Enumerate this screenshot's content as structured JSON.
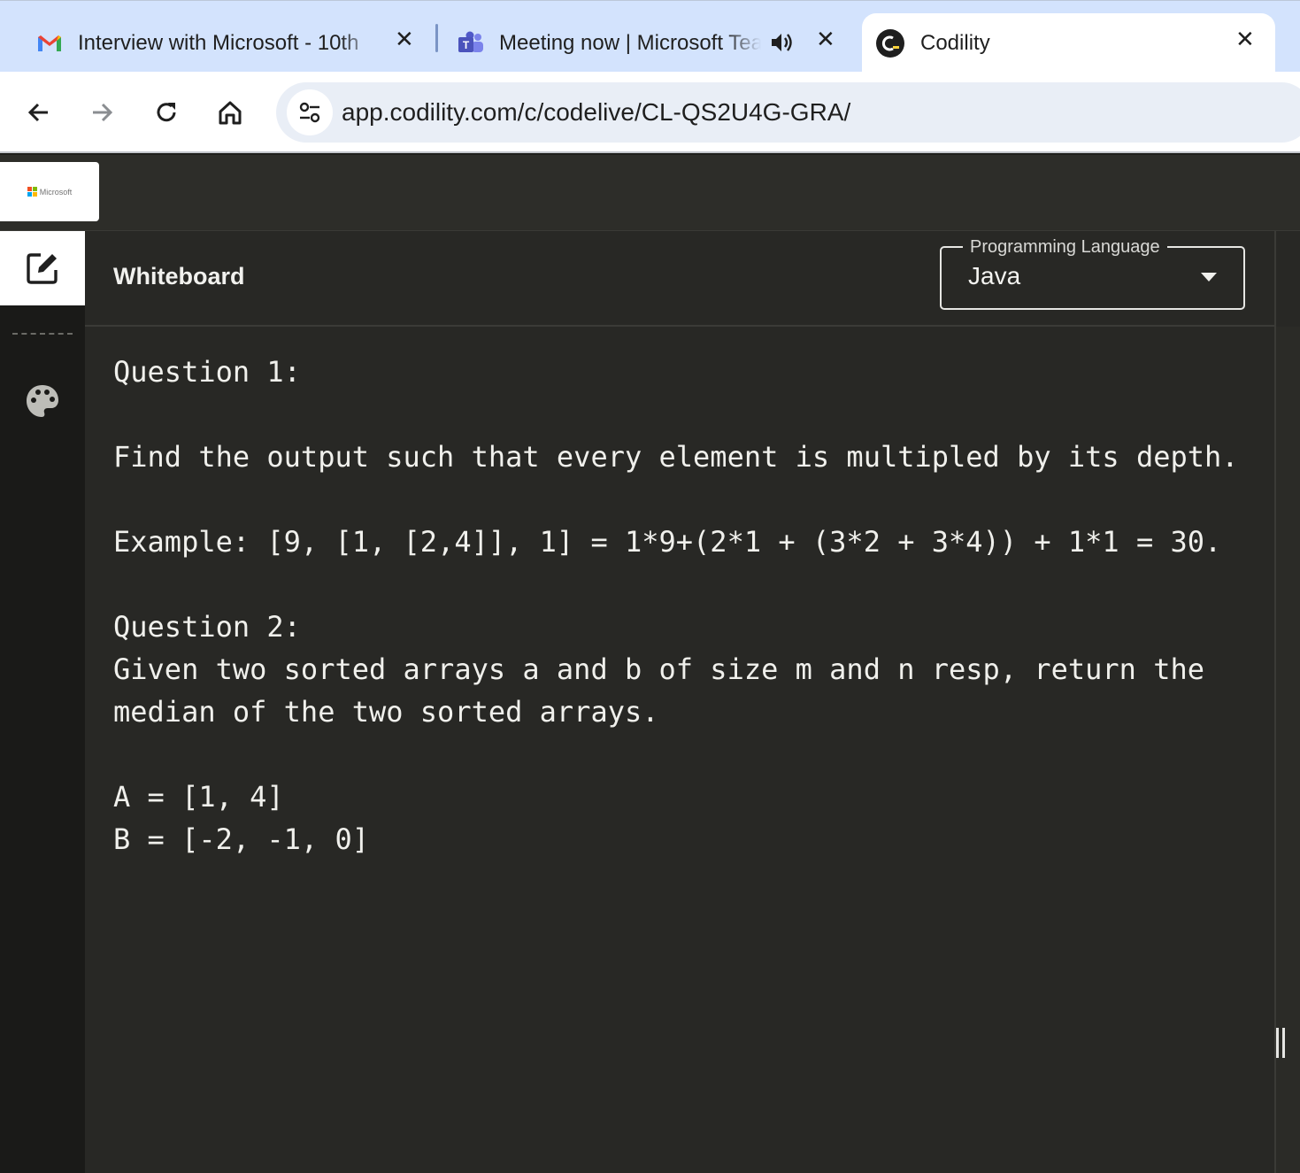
{
  "browser": {
    "tabs": [
      {
        "title": "Interview with Microsoft - 10th",
        "icon": "gmail-icon",
        "active": false
      },
      {
        "title": "Meeting now | Microsoft Teams",
        "icon": "teams-icon",
        "audio": true,
        "active": false
      },
      {
        "title": "Codility",
        "icon": "codility-icon",
        "active": true
      }
    ],
    "url": "app.codility.com/c/codelive/CL-QS2U4G-GRA/"
  },
  "app": {
    "logo_text": "Microsoft",
    "panel_title": "Whiteboard",
    "language_select": {
      "label": "Programming Language",
      "value": "Java"
    }
  },
  "whiteboard": {
    "lines": [
      "Question 1:",
      "Find the output such that every element is multipled by its depth.",
      "Example: [9, [1, [2,4]], 1] = 1*9+(2*1 + (3*2 + 3*4)) + 1*1 = 30.",
      "Question 2:",
      "Given two sorted arrays a and b of size m and n resp, return the",
      "median of the two sorted arrays.",
      "A = [1, 4]",
      "B = [-2, -1, 0]"
    ]
  },
  "colors": {
    "tabstrip": "#d3e3fd",
    "app_bg": "#282825",
    "rail_bg": "#1a1a18",
    "text": "#f0f0ec"
  }
}
